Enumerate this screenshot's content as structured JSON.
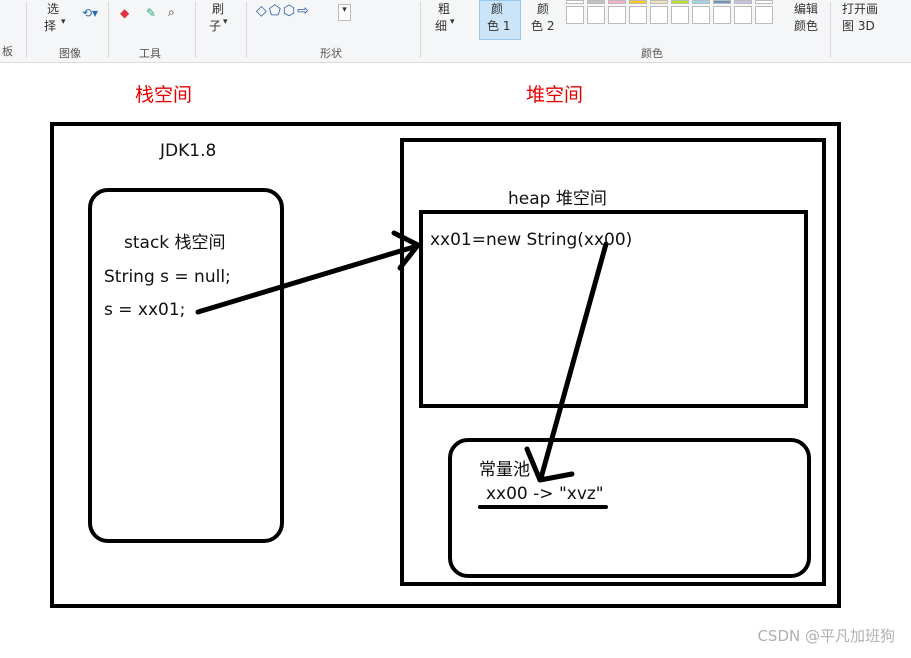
{
  "ribbon": {
    "select_label_1": "选",
    "select_label_2": "择",
    "image_group": "图像",
    "tools_group": "工具",
    "brush_label_1": "刷",
    "brush_label_2": "子",
    "shapes_group": "形状",
    "size_label_1": "粗",
    "size_label_2": "细",
    "color1_label_1": "颜",
    "color1_label_2": "色 1",
    "color2_label_1": "颜",
    "color2_label_2": "色 2",
    "colors_group": "颜色",
    "edit_colors_1": "编辑",
    "edit_colors_2": "颜色",
    "open_paint3d_1": "打开画",
    "open_paint3d_2": "图 3D",
    "left_edge_group": "板"
  },
  "labels": {
    "stack_space": "栈空间",
    "heap_space": "堆空间"
  },
  "diagram": {
    "jdk": "JDK1.8",
    "stack_title": "stack 栈空间",
    "stack_line1": "String s = null;",
    "stack_line2": "s = xx01;",
    "heap_title": "heap 堆空间",
    "heap_object": "xx01=new String(xx00)",
    "pool_title": "常量池",
    "pool_entry": "xx00 -> \"xvz\""
  },
  "watermark": "CSDN @平凡加班狗",
  "colors": {
    "label_red": "#e60000",
    "stroke": "#000000"
  }
}
